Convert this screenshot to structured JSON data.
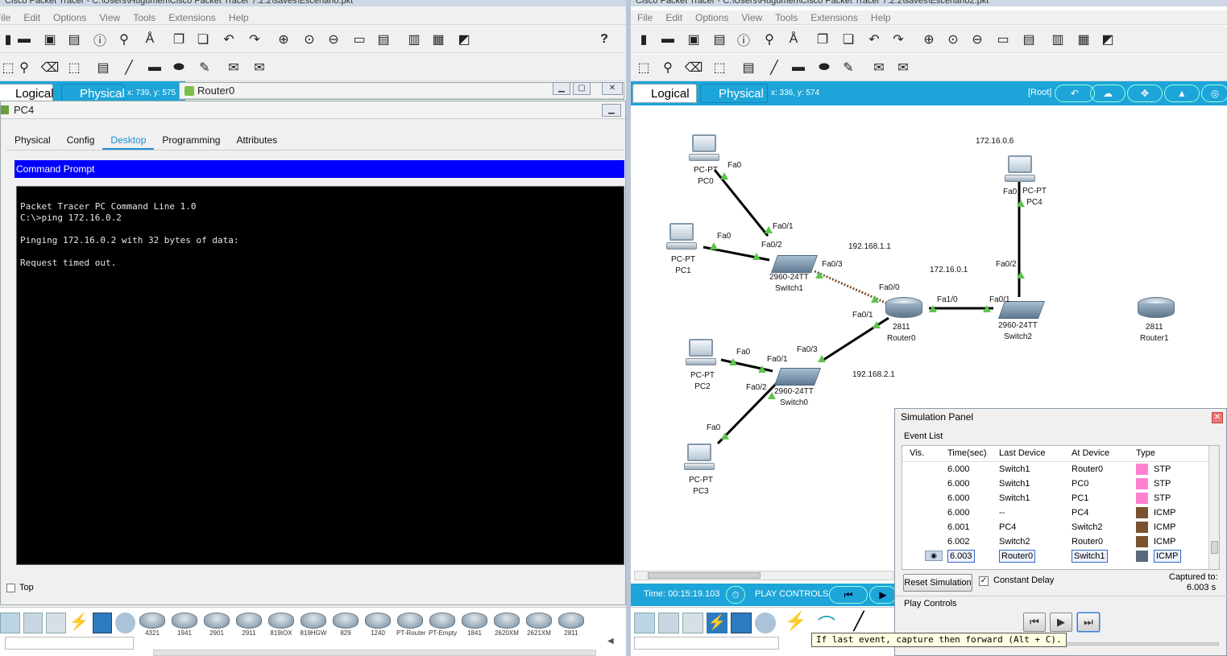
{
  "left_window": {
    "title": "Cisco Packet Tracer - C:\\Users\\Hugumen\\Cisco Packet Tracer 7.2.2\\saves\\Escenario.pkt",
    "menu": [
      "File",
      "Edit",
      "Options",
      "View",
      "Tools",
      "Extensions",
      "Help"
    ],
    "help_icon": "?",
    "logical_tab": "Logical",
    "physical_tab": "Physical",
    "coords": "x: 739, y: 575",
    "router_dialog_title": "Router0",
    "pc_dialog": {
      "title": "PC4",
      "tabs": [
        "Physical",
        "Config",
        "Desktop",
        "Programming",
        "Attributes"
      ],
      "active_tab": "Desktop",
      "cmd_header": "Command Prompt",
      "cmd_lines": [
        "Packet Tracer PC Command Line 1.0",
        "C:\\>ping 172.16.0.2",
        "",
        "Pinging 172.16.0.2 with 32 bytes of data:",
        "",
        "Request timed out."
      ],
      "top_checkbox": "Top"
    },
    "device_models": [
      "4321",
      "1941",
      "2901",
      "2911",
      "819IOX",
      "819HGW",
      "829",
      "1240",
      "PT-Router",
      "PT-Empty",
      "1841",
      "2620XM",
      "2621XM",
      "2811"
    ]
  },
  "right_window": {
    "title": "Cisco Packet Tracer - C:\\Users\\Hugumen\\Cisco Packet Tracer 7.2.2\\saves\\Escenario2.pkt",
    "menu": [
      "File",
      "Edit",
      "Options",
      "View",
      "Tools",
      "Extensions",
      "Help"
    ],
    "logical_tab": "Logical",
    "physical_tab": "Physical",
    "coords": "x: 336, y: 574",
    "root_label": "[Root]",
    "time_label": "Time: 00:15:19.103",
    "play_controls_label": "PLAY CONTROLS:"
  },
  "topology": {
    "devices": [
      {
        "id": "pc0",
        "model": "PC-PT",
        "name": "PC0"
      },
      {
        "id": "pc1",
        "model": "PC-PT",
        "name": "PC1"
      },
      {
        "id": "pc2",
        "model": "PC-PT",
        "name": "PC2"
      },
      {
        "id": "pc3",
        "model": "PC-PT",
        "name": "PC3"
      },
      {
        "id": "pc4",
        "model": "PC-PT",
        "name": "PC4"
      },
      {
        "id": "switch1",
        "model": "2960-24TT",
        "name": "Switch1"
      },
      {
        "id": "switch0",
        "model": "2960-24TT",
        "name": "Switch0"
      },
      {
        "id": "switch2",
        "model": "2960-24TT",
        "name": "Switch2"
      },
      {
        "id": "router0",
        "model": "2811",
        "name": "Router0"
      },
      {
        "id": "router1",
        "model": "2811",
        "name": "Router1"
      }
    ],
    "networks": [
      "172.16.0.6",
      "192.168.1.1",
      "172.16.0.1",
      "192.168.2.1"
    ],
    "ports": [
      "Fa0",
      "Fa0/1",
      "Fa0",
      "Fa0/2",
      "Fa0/3",
      "Fa0/0",
      "Fa1/0",
      "Fa0/1",
      "Fa0/1",
      "Fa0/3",
      "Fa0",
      "Fa0/1",
      "Fa0/2",
      "Fa0",
      "Fa0",
      "Fa0/2"
    ]
  },
  "simulation_panel": {
    "title": "Simulation Panel",
    "event_list_label": "Event List",
    "columns": [
      "Vis.",
      "Time(sec)",
      "Last Device",
      "At Device",
      "Type"
    ],
    "events": [
      {
        "time": "6.000",
        "last": "Switch1",
        "at": "Router0",
        "type": "STP",
        "color": "#ff80d0"
      },
      {
        "time": "6.000",
        "last": "Switch1",
        "at": "PC0",
        "type": "STP",
        "color": "#ff80d0"
      },
      {
        "time": "6.000",
        "last": "Switch1",
        "at": "PC1",
        "type": "STP",
        "color": "#ff80d0"
      },
      {
        "time": "6.000",
        "last": "--",
        "at": "PC4",
        "type": "ICMP",
        "color": "#7a5230"
      },
      {
        "time": "6.001",
        "last": "PC4",
        "at": "Switch2",
        "type": "ICMP",
        "color": "#7a5230"
      },
      {
        "time": "6.002",
        "last": "Switch2",
        "at": "Router0",
        "type": "ICMP",
        "color": "#7a5230"
      },
      {
        "time": "6.003",
        "last": "Router0",
        "at": "Switch1",
        "type": "ICMP",
        "color": "#5a6a7a"
      }
    ],
    "reset_button": "Reset Simulation",
    "constant_delay": "Constant Delay",
    "captured_label": "Captured to:",
    "captured_value": "6.003 s",
    "play_controls_label": "Play Controls",
    "tooltip": "If last event, capture then forward (Alt + C)."
  }
}
